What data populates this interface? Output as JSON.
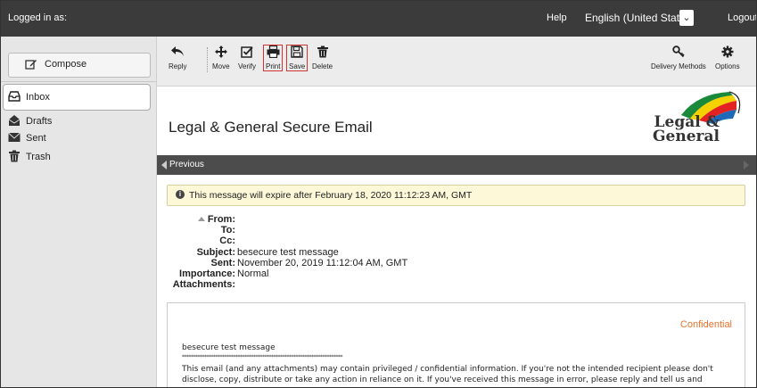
{
  "topbar": {
    "logged_in_label": "Logged in as:",
    "help": "Help",
    "language": "English (United States)",
    "logout": "Logout"
  },
  "sidebar": {
    "compose": "Compose",
    "folders": [
      {
        "label": "Inbox",
        "icon": "inbox-icon"
      },
      {
        "label": "Drafts",
        "icon": "drafts-icon"
      },
      {
        "label": "Sent",
        "icon": "sent-icon"
      },
      {
        "label": "Trash",
        "icon": "trash-icon"
      }
    ]
  },
  "toolbar": {
    "reply": "Reply",
    "move": "Move",
    "verify": "Verify",
    "print": "Print",
    "save": "Save",
    "delete": "Delete",
    "delivery_methods": "Delivery Methods",
    "options": "Options",
    "highlight_color": "#d13333"
  },
  "banner": {
    "title": "Legal & General Secure Email",
    "logo_text_line1": "Legal &",
    "logo_text_line2": "General"
  },
  "nav": {
    "previous": "Previous"
  },
  "expiry": {
    "text": "This message will expire after February 18, 2020 11:12:23 AM, GMT"
  },
  "headers": {
    "from_label": "From:",
    "to_label": "To:",
    "cc_label": "Cc:",
    "subject_label": "Subject:",
    "subject": "besecure test message",
    "sent_label": "Sent:",
    "sent": "November 20, 2019 11:12:04 AM, GMT",
    "importance_label": "Importance:",
    "importance": "Normal",
    "attachments_label": "Attachments:"
  },
  "message": {
    "confidential": "Confidential",
    "first_line": "besecure test message",
    "stars": "************************************************************************",
    "paragraph": "This email (and any attachments) may contain privileged / confidential information. If you're not the intended recipient please don't disclose, copy, distribute or take any action in reliance on it. If you've received this message in error, please reply and tell us and"
  },
  "colors": {
    "topbar": "#3b3b3b",
    "prevbar": "#4c4c4c",
    "confidential": "#e8732a",
    "expiry_bg": "#fcf8d8"
  }
}
